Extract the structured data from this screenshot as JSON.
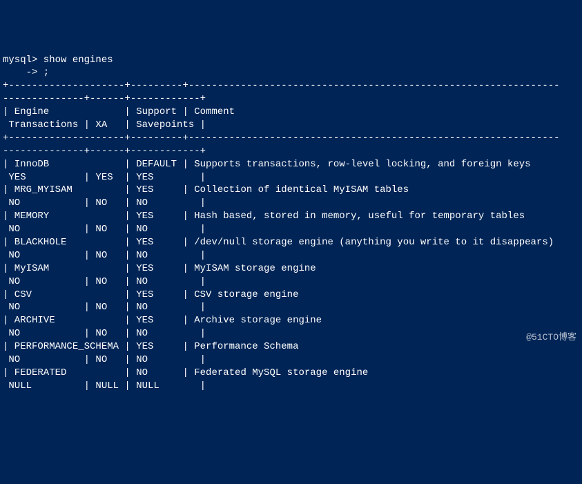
{
  "prompt_line1": "mysql> show engines",
  "prompt_line2": "    -> ;",
  "divider_top": "+--------------------+---------+----------------------------------------------------------------",
  "divider_mid": "--------------+------+------------+",
  "header_line1": "| Engine             | Support | Comment",
  "header_line2": " Transactions | XA   | Savepoints |",
  "rows": [
    {
      "l1": "| InnoDB             | DEFAULT | Supports transactions, row-level locking, and foreign keys",
      "l2": " YES          | YES  | YES        |"
    },
    {
      "l1": "| MRG_MYISAM         | YES     | Collection of identical MyISAM tables",
      "l2": " NO           | NO   | NO         |"
    },
    {
      "l1": "| MEMORY             | YES     | Hash based, stored in memory, useful for temporary tables",
      "l2": " NO           | NO   | NO         |"
    },
    {
      "l1": "| BLACKHOLE          | YES     | /dev/null storage engine (anything you write to it disappears)",
      "l2": " NO           | NO   | NO         |"
    },
    {
      "l1": "| MyISAM             | YES     | MyISAM storage engine",
      "l2": " NO           | NO   | NO         |"
    },
    {
      "l1": "| CSV                | YES     | CSV storage engine",
      "l2": " NO           | NO   | NO         |"
    },
    {
      "l1": "| ARCHIVE            | YES     | Archive storage engine",
      "l2": " NO           | NO   | NO         |"
    },
    {
      "l1": "| PERFORMANCE_SCHEMA | YES     | Performance Schema",
      "l2": " NO           | NO   | NO         |"
    },
    {
      "l1": "| FEDERATED          | NO      | Federated MySQL storage engine",
      "l2": " NULL         | NULL | NULL       |"
    }
  ],
  "watermark": "@51CTO博客",
  "chart_data": {
    "type": "table",
    "title": "MySQL SHOW ENGINES output",
    "columns": [
      "Engine",
      "Support",
      "Comment",
      "Transactions",
      "XA",
      "Savepoints"
    ],
    "rows": [
      [
        "InnoDB",
        "DEFAULT",
        "Supports transactions, row-level locking, and foreign keys",
        "YES",
        "YES",
        "YES"
      ],
      [
        "MRG_MYISAM",
        "YES",
        "Collection of identical MyISAM tables",
        "NO",
        "NO",
        "NO"
      ],
      [
        "MEMORY",
        "YES",
        "Hash based, stored in memory, useful for temporary tables",
        "NO",
        "NO",
        "NO"
      ],
      [
        "BLACKHOLE",
        "YES",
        "/dev/null storage engine (anything you write to it disappears)",
        "NO",
        "NO",
        "NO"
      ],
      [
        "MyISAM",
        "YES",
        "MyISAM storage engine",
        "NO",
        "NO",
        "NO"
      ],
      [
        "CSV",
        "YES",
        "CSV storage engine",
        "NO",
        "NO",
        "NO"
      ],
      [
        "ARCHIVE",
        "YES",
        "Archive storage engine",
        "NO",
        "NO",
        "NO"
      ],
      [
        "PERFORMANCE_SCHEMA",
        "YES",
        "Performance Schema",
        "NO",
        "NO",
        "NO"
      ],
      [
        "FEDERATED",
        "NO",
        "Federated MySQL storage engine",
        "NULL",
        "NULL",
        "NULL"
      ]
    ]
  }
}
